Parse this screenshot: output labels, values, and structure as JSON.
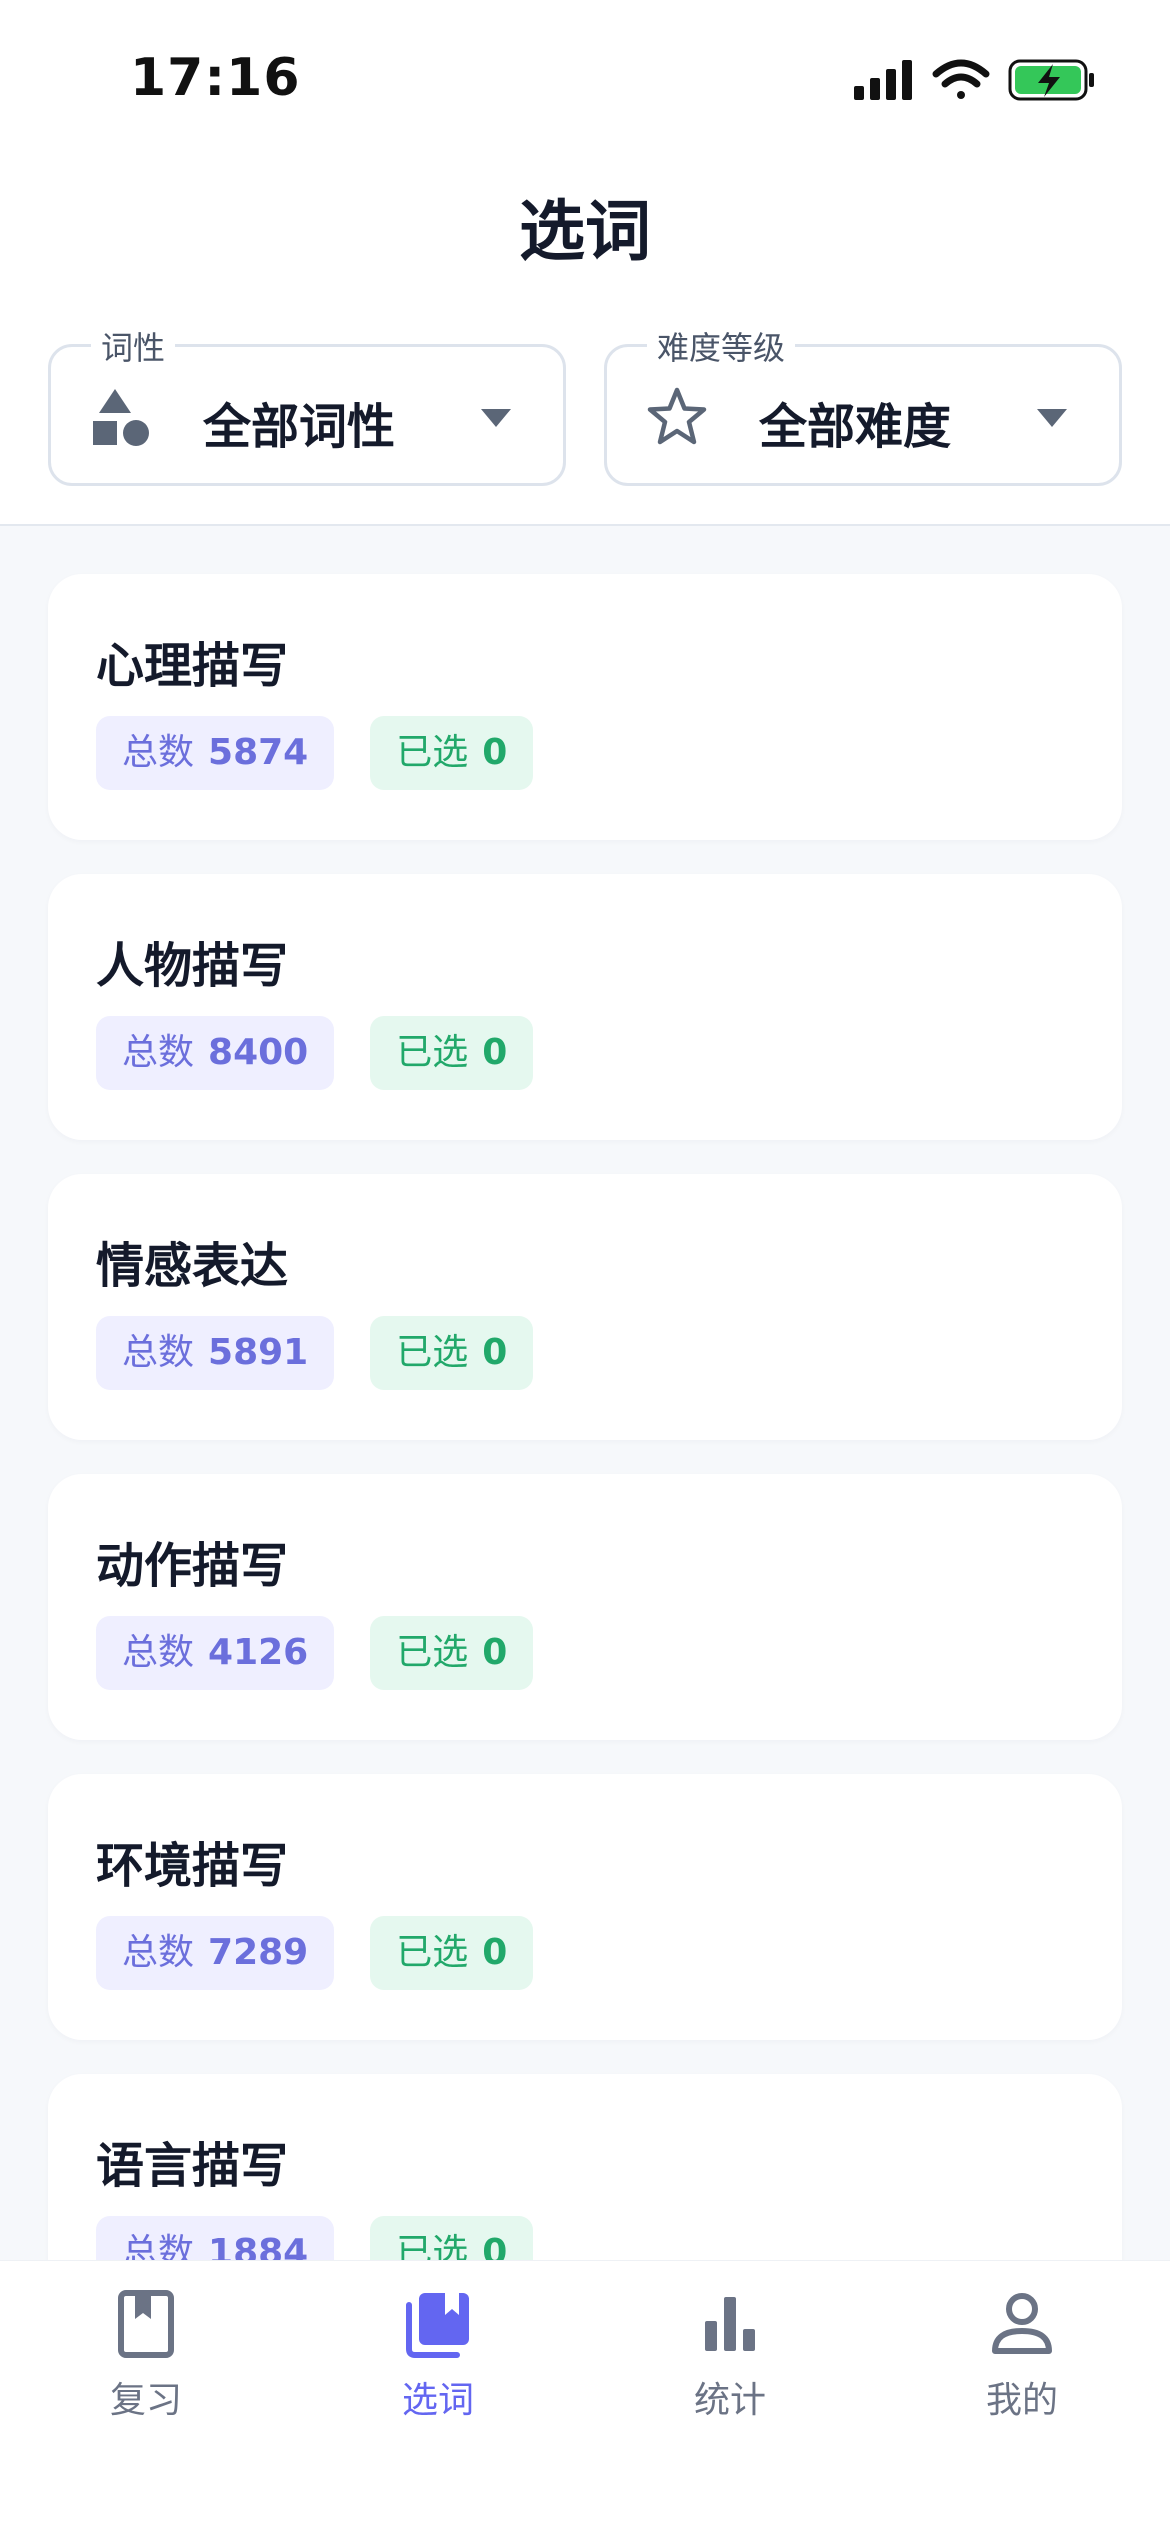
{
  "status_bar": {
    "time": "17:16"
  },
  "header": {
    "title": "选词"
  },
  "filters": [
    {
      "label": "词性",
      "value": "全部词性",
      "icon": "shapes-icon"
    },
    {
      "label": "难度等级",
      "value": "全部难度",
      "icon": "star-icon"
    }
  ],
  "categories": [
    {
      "name": "心理描写",
      "total_label": "总数",
      "total": "5874",
      "selected_label": "已选",
      "selected": "0"
    },
    {
      "name": "人物描写",
      "total_label": "总数",
      "total": "8400",
      "selected_label": "已选",
      "selected": "0"
    },
    {
      "name": "情感表达",
      "total_label": "总数",
      "total": "5891",
      "selected_label": "已选",
      "selected": "0"
    },
    {
      "name": "动作描写",
      "total_label": "总数",
      "total": "4126",
      "selected_label": "已选",
      "selected": "0"
    },
    {
      "name": "环境描写",
      "total_label": "总数",
      "total": "7289",
      "selected_label": "已选",
      "selected": "0"
    },
    {
      "name": "语言描写",
      "total_label": "总数",
      "total": "1884",
      "selected_label": "已选",
      "selected": "0"
    }
  ],
  "tabs": [
    {
      "label": "复习",
      "icon": "book-icon",
      "active": false
    },
    {
      "label": "选词",
      "icon": "library-icon",
      "active": true
    },
    {
      "label": "统计",
      "icon": "bar-chart-icon",
      "active": false
    },
    {
      "label": "我的",
      "icon": "person-icon",
      "active": false
    }
  ],
  "colors": {
    "accent": "#6366f1",
    "total_badge_bg": "#efefff",
    "total_badge_text": "#6b6fdc",
    "selected_badge_bg": "#e5f8ef",
    "selected_badge_text": "#21a86a",
    "background": "#f6f8fb"
  }
}
